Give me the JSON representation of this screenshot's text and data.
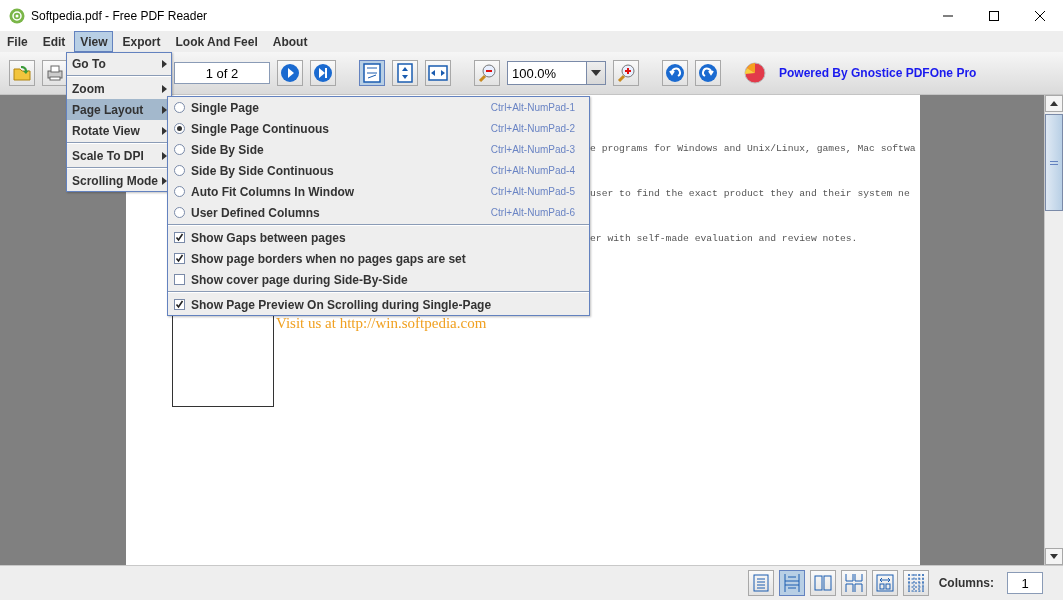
{
  "window": {
    "title": "Softpedia.pdf - Free PDF Reader"
  },
  "menu_bar": [
    {
      "label": "File",
      "selected": false
    },
    {
      "label": "Edit",
      "selected": false
    },
    {
      "label": "View",
      "selected": true
    },
    {
      "label": "Export",
      "selected": false
    },
    {
      "label": "Look And Feel",
      "selected": false
    },
    {
      "label": "About",
      "selected": false
    }
  ],
  "toolbar": {
    "groups": [
      [
        {
          "kind": "open"
        },
        {
          "kind": "print"
        }
      ],
      [
        {
          "kind": "page-field",
          "value": "1 of 2"
        },
        {
          "kind": "next"
        },
        {
          "kind": "last"
        }
      ],
      [
        {
          "kind": "actual-size",
          "selected": true
        },
        {
          "kind": "fit-height",
          "selected": false
        },
        {
          "kind": "fit-width",
          "selected": false
        }
      ],
      [
        {
          "kind": "zoom-out"
        },
        {
          "kind": "zoom-field",
          "value": "100.0%"
        },
        {
          "kind": "zoom-in"
        }
      ],
      [
        {
          "kind": "rotate-left"
        },
        {
          "kind": "rotate-right"
        }
      ],
      [
        {
          "kind": "brand",
          "label": "Powered By Gnostice PDFOne Pro"
        }
      ]
    ]
  },
  "document": {
    "lines": [
      "e programs for Windows and Unix/Linux, games, Mac softwa",
      "user to find the exact product they and their system ne",
      "er with self-made evaluation and review notes."
    ],
    "link": "Visit us at http://win.softpedia.com"
  },
  "view_menu": {
    "sections": [
      [
        {
          "label": "Go To",
          "selected": false
        }
      ],
      [
        {
          "label": "Zoom",
          "selected": false
        },
        {
          "label": "Page Layout",
          "selected": true
        },
        {
          "label": "Rotate View",
          "selected": false
        }
      ],
      [
        {
          "label": "Scale To DPI",
          "selected": false
        }
      ],
      [
        {
          "label": "Scrolling Mode",
          "selected": false
        }
      ]
    ]
  },
  "page_layout_menu": {
    "sections": [
      [
        {
          "kind": "radio",
          "label": "Single Page",
          "shortcut": "Ctrl+Alt-NumPad-1",
          "checked": false
        },
        {
          "kind": "radio",
          "label": "Single Page Continuous",
          "shortcut": "Ctrl+Alt-NumPad-2",
          "checked": true
        },
        {
          "kind": "radio",
          "label": "Side By Side",
          "shortcut": "Ctrl+Alt-NumPad-3",
          "checked": false
        },
        {
          "kind": "radio",
          "label": "Side By Side Continuous",
          "shortcut": "Ctrl+Alt-NumPad-4",
          "checked": false
        },
        {
          "kind": "radio",
          "label": "Auto Fit Columns In Window",
          "shortcut": "Ctrl+Alt-NumPad-5",
          "checked": false
        },
        {
          "kind": "radio",
          "label": "User Defined Columns",
          "shortcut": "Ctrl+Alt-NumPad-6",
          "checked": false
        }
      ],
      [
        {
          "kind": "check",
          "label": "Show Gaps between pages",
          "checked": true
        },
        {
          "kind": "check",
          "label": "Show page borders when no pages gaps are set",
          "checked": true
        },
        {
          "kind": "check",
          "label": "Show cover page during Side-By-Side",
          "checked": false
        }
      ],
      [
        {
          "kind": "check",
          "label": "Show Page Preview On Scrolling during Single-Page",
          "checked": true
        }
      ]
    ]
  },
  "status_bar": {
    "view_buttons": [
      {
        "kind": "single",
        "selected": false
      },
      {
        "kind": "continuous",
        "selected": true
      },
      {
        "kind": "side",
        "selected": false
      },
      {
        "kind": "side-continuous",
        "selected": false
      },
      {
        "kind": "auto-fit",
        "selected": false
      },
      {
        "kind": "columns",
        "selected": false
      }
    ],
    "columns_label": "Columns:",
    "columns_value": "1"
  }
}
